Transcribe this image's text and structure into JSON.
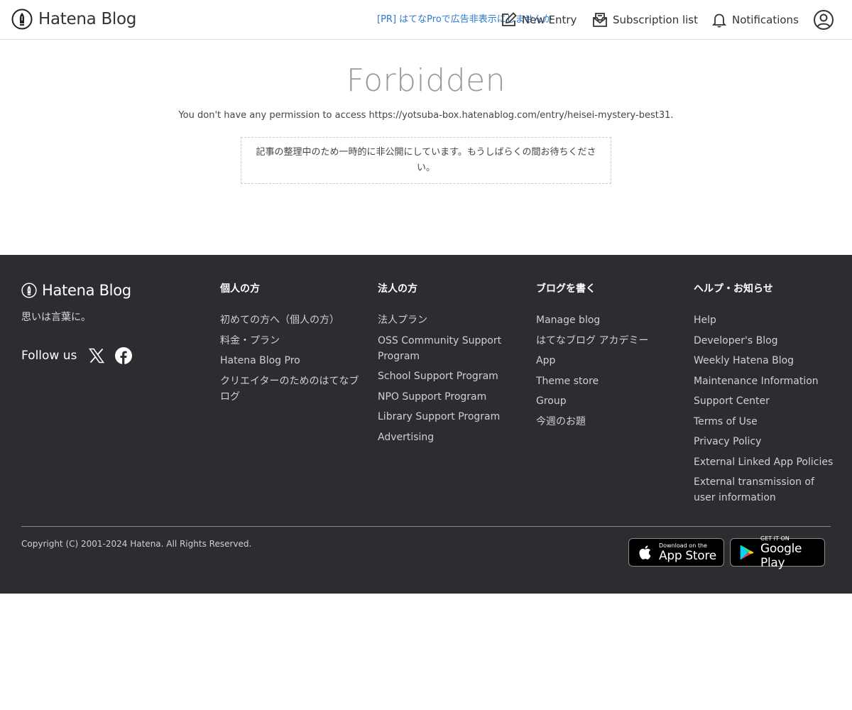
{
  "header": {
    "logo_text": "Hatena Blog",
    "pr_link": "[PR] はてなProで広告非表示にしませんか",
    "nav": {
      "new_entry": "New Entry",
      "subscription_list": "Subscription list",
      "notifications": "Notifications"
    },
    "colors": {
      "pr_link": "#2e7ad1"
    }
  },
  "main": {
    "title": "Forbidden",
    "permission_text": "You don't have any permission to access https://yotsuba-box.hatenablog.com/entry/heisei-mystery-best31.",
    "notice": "記事の整理中のため一時的に非公開にしています。もうしばらくの間お待ちください。"
  },
  "footer": {
    "logo_text": "Hatena Blog",
    "tagline": "思いは言葉に。",
    "follow_label": "Follow us",
    "social_icons": [
      "x-icon",
      "facebook-icon"
    ],
    "columns": [
      {
        "heading": "個人の方",
        "links": [
          "初めての方へ（個人の方）",
          "料金・プラン",
          "Hatena Blog Pro",
          "クリエイターのためのはてなブログ"
        ]
      },
      {
        "heading": "法人の方",
        "links": [
          "法人プラン",
          "OSS Community Support Program",
          "School Support Program",
          "NPO Support Program",
          "Library Support Program",
          "Advertising"
        ]
      },
      {
        "heading": "ブログを書く",
        "links": [
          "Manage blog",
          "はてなブログ アカデミー",
          "App",
          "Theme store",
          "Group",
          "今週のお題"
        ]
      },
      {
        "heading": "ヘルプ・お知らせ",
        "links": [
          "Help",
          "Developer's Blog",
          "Weekly Hatena Blog",
          "Maintenance Information",
          "Support Center",
          "Terms of Use",
          "Privacy Policy",
          "External Linked App Policies",
          "External transmission of user information"
        ]
      }
    ],
    "copyright": "Copyright (C) 2001-2024 Hatena. All Rights Reserved.",
    "app_store": {
      "small": "Download on the",
      "big": "App Store"
    },
    "google_play": {
      "small": "GET IT ON",
      "big": "Google Play"
    },
    "colors": {
      "background": "#2b2d30"
    }
  }
}
